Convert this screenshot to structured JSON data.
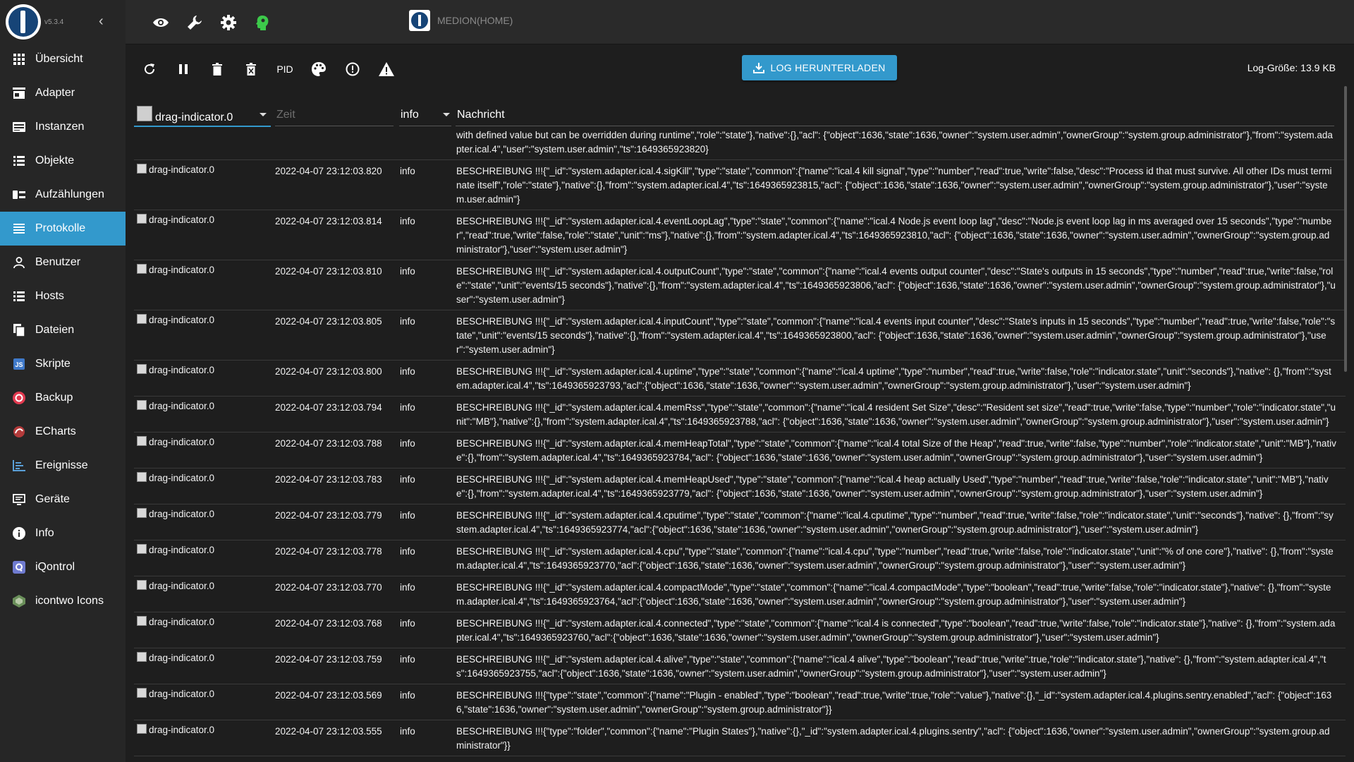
{
  "app": {
    "version": "v5.3.4",
    "host": "MEDION(HOME)"
  },
  "sidebar": {
    "items": [
      {
        "label": "Übersicht",
        "icon": "grid-icon"
      },
      {
        "label": "Adapter",
        "icon": "store-icon"
      },
      {
        "label": "Instanzen",
        "icon": "instances-icon"
      },
      {
        "label": "Objekte",
        "icon": "list-icon"
      },
      {
        "label": "Aufzählungen",
        "icon": "enum-icon"
      },
      {
        "label": "Protokolle",
        "icon": "log-icon",
        "active": true
      },
      {
        "label": "Benutzer",
        "icon": "user-icon"
      },
      {
        "label": "Hosts",
        "icon": "hosts-icon"
      },
      {
        "label": "Dateien",
        "icon": "files-icon"
      },
      {
        "label": "Skripte",
        "icon": "js-icon"
      },
      {
        "label": "Backup",
        "icon": "backup-icon"
      },
      {
        "label": "ECharts",
        "icon": "echarts-icon"
      },
      {
        "label": "Ereignisse",
        "icon": "events-icon"
      },
      {
        "label": "Geräte",
        "icon": "devices-icon"
      },
      {
        "label": "Info",
        "icon": "info-icon"
      },
      {
        "label": "iQontrol",
        "icon": "iqontrol-icon"
      },
      {
        "label": "icontwo Icons",
        "icon": "icontwo-icon"
      }
    ]
  },
  "toolbar": {
    "pid_label": "PID",
    "download_label": "LOG HERUNTERLADEN",
    "log_size": "Log-Größe: 13.9 KB"
  },
  "filters": {
    "source": "drag-indicator.0",
    "time_placeholder": "Zeit",
    "severity": "info",
    "message_header": "Nachricht"
  },
  "logs": [
    {
      "source": "",
      "time": "",
      "severity": "",
      "message": "with defined value but can be overridden during runtime\",\"role\":\"state\"},\"native\":{},\"acl\": {\"object\":1636,\"state\":1636,\"owner\":\"system.user.admin\",\"ownerGroup\":\"system.group.administrator\"},\"from\":\"system.adapter.ical.4\",\"user\":\"system.user.admin\",\"ts\":1649365923820}"
    },
    {
      "source": "drag-indicator.0",
      "time": "2022-04-07 23:12:03.820",
      "severity": "info",
      "message": "BESCHREIBUNG !!!{\"_id\":\"system.adapter.ical.4.sigKill\",\"type\":\"state\",\"common\":{\"name\":\"ical.4 kill signal\",\"type\":\"number\",\"read\":true,\"write\":false,\"desc\":\"Process id that must survive. All other IDs must terminate itself\",\"role\":\"state\"},\"native\":{},\"from\":\"system.adapter.ical.4\",\"ts\":1649365923815,\"acl\": {\"object\":1636,\"state\":1636,\"owner\":\"system.user.admin\",\"ownerGroup\":\"system.group.administrator\"},\"user\":\"system.user.admin\"}"
    },
    {
      "source": "drag-indicator.0",
      "time": "2022-04-07 23:12:03.814",
      "severity": "info",
      "message": "BESCHREIBUNG !!!{\"_id\":\"system.adapter.ical.4.eventLoopLag\",\"type\":\"state\",\"common\":{\"name\":\"ical.4 Node.js event loop lag\",\"desc\":\"Node.js event loop lag in ms averaged over 15 seconds\",\"type\":\"number\",\"read\":true,\"write\":false,\"role\":\"state\",\"unit\":\"ms\"},\"native\":{},\"from\":\"system.adapter.ical.4\",\"ts\":1649365923810,\"acl\": {\"object\":1636,\"state\":1636,\"owner\":\"system.user.admin\",\"ownerGroup\":\"system.group.administrator\"},\"user\":\"system.user.admin\"}"
    },
    {
      "source": "drag-indicator.0",
      "time": "2022-04-07 23:12:03.810",
      "severity": "info",
      "message": "BESCHREIBUNG !!!{\"_id\":\"system.adapter.ical.4.outputCount\",\"type\":\"state\",\"common\":{\"name\":\"ical.4 events output counter\",\"desc\":\"State's outputs in 15 seconds\",\"type\":\"number\",\"read\":true,\"write\":false,\"role\":\"state\",\"unit\":\"events/15 seconds\"},\"native\":{},\"from\":\"system.adapter.ical.4\",\"ts\":1649365923806,\"acl\": {\"object\":1636,\"state\":1636,\"owner\":\"system.user.admin\",\"ownerGroup\":\"system.group.administrator\"},\"user\":\"system.user.admin\"}"
    },
    {
      "source": "drag-indicator.0",
      "time": "2022-04-07 23:12:03.805",
      "severity": "info",
      "message": "BESCHREIBUNG !!!{\"_id\":\"system.adapter.ical.4.inputCount\",\"type\":\"state\",\"common\":{\"name\":\"ical.4 events input counter\",\"desc\":\"State's inputs in 15 seconds\",\"type\":\"number\",\"read\":true,\"write\":false,\"role\":\"state\",\"unit\":\"events/15 seconds\"},\"native\":{},\"from\":\"system.adapter.ical.4\",\"ts\":1649365923800,\"acl\": {\"object\":1636,\"state\":1636,\"owner\":\"system.user.admin\",\"ownerGroup\":\"system.group.administrator\"},\"user\":\"system.user.admin\"}"
    },
    {
      "source": "drag-indicator.0",
      "time": "2022-04-07 23:12:03.800",
      "severity": "info",
      "message": "BESCHREIBUNG !!!{\"_id\":\"system.adapter.ical.4.uptime\",\"type\":\"state\",\"common\":{\"name\":\"ical.4 uptime\",\"type\":\"number\",\"read\":true,\"write\":false,\"role\":\"indicator.state\",\"unit\":\"seconds\"},\"native\": {},\"from\":\"system.adapter.ical.4\",\"ts\":1649365923793,\"acl\":{\"object\":1636,\"state\":1636,\"owner\":\"system.user.admin\",\"ownerGroup\":\"system.group.administrator\"},\"user\":\"system.user.admin\"}"
    },
    {
      "source": "drag-indicator.0",
      "time": "2022-04-07 23:12:03.794",
      "severity": "info",
      "message": "BESCHREIBUNG !!!{\"_id\":\"system.adapter.ical.4.memRss\",\"type\":\"state\",\"common\":{\"name\":\"ical.4 resident Set Size\",\"desc\":\"Resident set size\",\"read\":true,\"write\":false,\"type\":\"number\",\"role\":\"indicator.state\",\"unit\":\"MB\"},\"native\":{},\"from\":\"system.adapter.ical.4\",\"ts\":1649365923788,\"acl\": {\"object\":1636,\"state\":1636,\"owner\":\"system.user.admin\",\"ownerGroup\":\"system.group.administrator\"},\"user\":\"system.user.admin\"}"
    },
    {
      "source": "drag-indicator.0",
      "time": "2022-04-07 23:12:03.788",
      "severity": "info",
      "message": "BESCHREIBUNG !!!{\"_id\":\"system.adapter.ical.4.memHeapTotal\",\"type\":\"state\",\"common\":{\"name\":\"ical.4 total Size of the Heap\",\"read\":true,\"write\":false,\"type\":\"number\",\"role\":\"indicator.state\",\"unit\":\"MB\"},\"native\":{},\"from\":\"system.adapter.ical.4\",\"ts\":1649365923784,\"acl\": {\"object\":1636,\"state\":1636,\"owner\":\"system.user.admin\",\"ownerGroup\":\"system.group.administrator\"},\"user\":\"system.user.admin\"}"
    },
    {
      "source": "drag-indicator.0",
      "time": "2022-04-07 23:12:03.783",
      "severity": "info",
      "message": "BESCHREIBUNG !!!{\"_id\":\"system.adapter.ical.4.memHeapUsed\",\"type\":\"state\",\"common\":{\"name\":\"ical.4 heap actually Used\",\"type\":\"number\",\"read\":true,\"write\":false,\"role\":\"indicator.state\",\"unit\":\"MB\"},\"native\":{},\"from\":\"system.adapter.ical.4\",\"ts\":1649365923779,\"acl\": {\"object\":1636,\"state\":1636,\"owner\":\"system.user.admin\",\"ownerGroup\":\"system.group.administrator\"},\"user\":\"system.user.admin\"}"
    },
    {
      "source": "drag-indicator.0",
      "time": "2022-04-07 23:12:03.779",
      "severity": "info",
      "message": "BESCHREIBUNG !!!{\"_id\":\"system.adapter.ical.4.cputime\",\"type\":\"state\",\"common\":{\"name\":\"ical.4.cputime\",\"type\":\"number\",\"read\":true,\"write\":false,\"role\":\"indicator.state\",\"unit\":\"seconds\"},\"native\": {},\"from\":\"system.adapter.ical.4\",\"ts\":1649365923774,\"acl\":{\"object\":1636,\"state\":1636,\"owner\":\"system.user.admin\",\"ownerGroup\":\"system.group.administrator\"},\"user\":\"system.user.admin\"}"
    },
    {
      "source": "drag-indicator.0",
      "time": "2022-04-07 23:12:03.778",
      "severity": "info",
      "message": "BESCHREIBUNG !!!{\"_id\":\"system.adapter.ical.4.cpu\",\"type\":\"state\",\"common\":{\"name\":\"ical.4.cpu\",\"type\":\"number\",\"read\":true,\"write\":false,\"role\":\"indicator.state\",\"unit\":\"% of one core\"},\"native\": {},\"from\":\"system.adapter.ical.4\",\"ts\":1649365923770,\"acl\":{\"object\":1636,\"state\":1636,\"owner\":\"system.user.admin\",\"ownerGroup\":\"system.group.administrator\"},\"user\":\"system.user.admin\"}"
    },
    {
      "source": "drag-indicator.0",
      "time": "2022-04-07 23:12:03.770",
      "severity": "info",
      "message": "BESCHREIBUNG !!!{\"_id\":\"system.adapter.ical.4.compactMode\",\"type\":\"state\",\"common\":{\"name\":\"ical.4.compactMode\",\"type\":\"boolean\",\"read\":true,\"write\":false,\"role\":\"indicator.state\"},\"native\": {},\"from\":\"system.adapter.ical.4\",\"ts\":1649365923764,\"acl\":{\"object\":1636,\"state\":1636,\"owner\":\"system.user.admin\",\"ownerGroup\":\"system.group.administrator\"},\"user\":\"system.user.admin\"}"
    },
    {
      "source": "drag-indicator.0",
      "time": "2022-04-07 23:12:03.768",
      "severity": "info",
      "message": "BESCHREIBUNG !!!{\"_id\":\"system.adapter.ical.4.connected\",\"type\":\"state\",\"common\":{\"name\":\"ical.4 is connected\",\"type\":\"boolean\",\"read\":true,\"write\":false,\"role\":\"indicator.state\"},\"native\": {},\"from\":\"system.adapter.ical.4\",\"ts\":1649365923760,\"acl\":{\"object\":1636,\"state\":1636,\"owner\":\"system.user.admin\",\"ownerGroup\":\"system.group.administrator\"},\"user\":\"system.user.admin\"}"
    },
    {
      "source": "drag-indicator.0",
      "time": "2022-04-07 23:12:03.759",
      "severity": "info",
      "message": "BESCHREIBUNG !!!{\"_id\":\"system.adapter.ical.4.alive\",\"type\":\"state\",\"common\":{\"name\":\"ical.4 alive\",\"type\":\"boolean\",\"read\":true,\"write\":true,\"role\":\"indicator.state\"},\"native\": {},\"from\":\"system.adapter.ical.4\",\"ts\":1649365923755,\"acl\":{\"object\":1636,\"state\":1636,\"owner\":\"system.user.admin\",\"ownerGroup\":\"system.group.administrator\"},\"user\":\"system.user.admin\"}"
    },
    {
      "source": "drag-indicator.0",
      "time": "2022-04-07 23:12:03.569",
      "severity": "info",
      "message": "BESCHREIBUNG !!!{\"type\":\"state\",\"common\":{\"name\":\"Plugin - enabled\",\"type\":\"boolean\",\"read\":true,\"write\":true,\"role\":\"value\"},\"native\":{},\"_id\":\"system.adapter.ical.4.plugins.sentry.enabled\",\"acl\": {\"object\":1636,\"state\":1636,\"owner\":\"system.user.admin\",\"ownerGroup\":\"system.group.administrator\"}}"
    },
    {
      "source": "drag-indicator.0",
      "time": "2022-04-07 23:12:03.555",
      "severity": "info",
      "message": "BESCHREIBUNG !!!{\"type\":\"folder\",\"common\":{\"name\":\"Plugin States\"},\"native\":{},\"_id\":\"system.adapter.ical.4.plugins.sentry\",\"acl\": {\"object\":1636,\"owner\":\"system.user.admin\",\"ownerGroup\":\"system.group.administrator\"}}"
    }
  ]
}
